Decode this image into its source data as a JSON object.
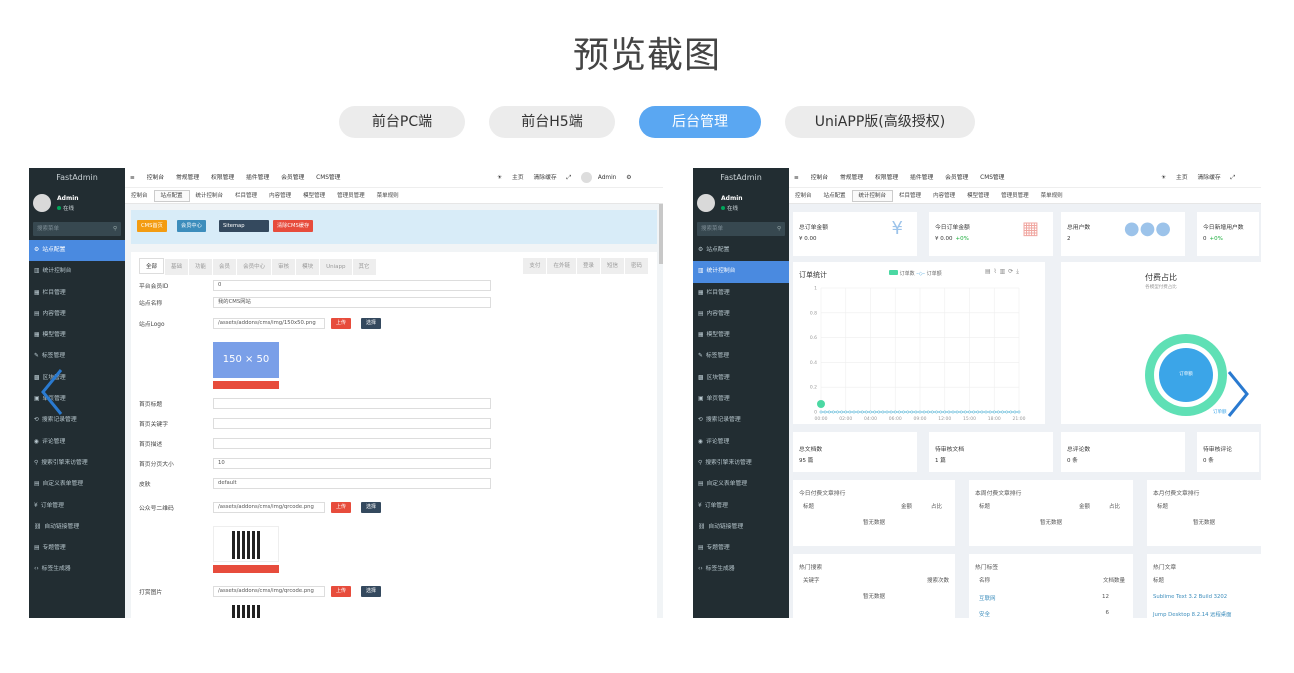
{
  "page_title": "预览截图",
  "tabs": [
    {
      "label": "前台PC端"
    },
    {
      "label": "前台H5端"
    },
    {
      "label": "后台管理"
    },
    {
      "label": "UniAPP版(高级授权)"
    }
  ],
  "colors": {
    "accent": "#5aa7f2",
    "sidebar": "#222d32",
    "active_menu": "#4a8ae0"
  },
  "shot1": {
    "brand": "FastAdmin",
    "user": "Admin",
    "status": "在线",
    "search_placeholder": "搜索菜单",
    "menu": [
      "站点配置",
      "统计控制台",
      "栏目管理",
      "内容管理",
      "模型管理",
      "标签管理",
      "区块管理",
      "单页管理",
      "搜索记录管理",
      "评论管理",
      "搜索引擎来访管理",
      "自定义表单管理",
      "订单管理",
      "自动链接管理",
      "专题管理",
      "标签生成器"
    ],
    "top_nav": [
      "控制台",
      "常规管理",
      "权限管理",
      "插件管理",
      "会员管理",
      "CMS管理"
    ],
    "top_right": [
      "主页",
      "清除缓存",
      "Admin"
    ],
    "sub_tabs": [
      "控制台",
      "站点配置",
      "统计控制台",
      "栏目管理",
      "内容管理",
      "模型管理",
      "管理员管理",
      "菜单规则"
    ],
    "buttons": [
      "CMS首页",
      "会员中心",
      "Sitemap",
      "清除CMS缓存"
    ],
    "form_tabs": [
      "全部",
      "基础",
      "功能",
      "会员",
      "会员中心",
      "审核",
      "模块",
      "Uniapp",
      "其它"
    ],
    "form_tabs_right": [
      "支付",
      "在外链",
      "登录",
      "短信",
      "密码"
    ],
    "fields": [
      {
        "label": "平台会员ID",
        "value": "0"
      },
      {
        "label": "站点名称",
        "value": "我的CMS网站"
      },
      {
        "label": "站点Logo",
        "value": "/assets/addons/cms/img/150x50.png"
      },
      {
        "label": "首页标题",
        "value": ""
      },
      {
        "label": "首页关键字",
        "value": ""
      },
      {
        "label": "首页描述",
        "value": ""
      },
      {
        "label": "首页分页大小",
        "value": "10"
      },
      {
        "label": "皮肤",
        "value": "default"
      },
      {
        "label": "公众号二维码",
        "value": "/assets/addons/cms/img/qrcode.png"
      },
      {
        "label": "打赏图片",
        "value": "/assets/addons/cms/img/qrcode.png"
      }
    ],
    "upload": "上传",
    "choose": "选择",
    "logo_text": "150 × 50"
  },
  "shot2": {
    "brand": "FastAdmin",
    "user": "Admin",
    "status": "在线",
    "search_placeholder": "搜索菜单",
    "menu": [
      "站点配置",
      "统计控制台",
      "栏目管理",
      "内容管理",
      "模型管理",
      "标签管理",
      "区块管理",
      "单页管理",
      "搜索记录管理",
      "评论管理",
      "搜索引擎来访管理",
      "自定义表单管理",
      "订单管理",
      "自动链接管理",
      "专题管理",
      "标签生成器"
    ],
    "top_nav": [
      "控制台",
      "常规管理",
      "权限管理",
      "插件管理",
      "会员管理",
      "CMS管理"
    ],
    "top_right": [
      "主页",
      "清除缓存"
    ],
    "sub_tabs": [
      "控制台",
      "站点配置",
      "统计控制台",
      "栏目管理",
      "内容管理",
      "模型管理",
      "管理员管理",
      "菜单规则"
    ],
    "stats": [
      {
        "title": "总订单金额",
        "value": "¥ 0.00",
        "extra": ""
      },
      {
        "title": "今日订单金额",
        "value": "¥ 0.00",
        "extra": "+0%"
      },
      {
        "title": "总用户数",
        "value": "2",
        "extra": ""
      },
      {
        "title": "今日新增用户数",
        "value": "0",
        "extra": "+0%"
      }
    ],
    "chart_title": "订单统计",
    "chart_legend": [
      "订单数",
      "订单额"
    ],
    "pie_title": "付费占比",
    "pie_subtitle": "各模型付费占比",
    "pie_label": "订单额",
    "pie_outer_label": "订单额",
    "counts": [
      {
        "title": "总文档数",
        "value": "95 篇"
      },
      {
        "title": "待审核文档",
        "value": "1 篇"
      },
      {
        "title": "总评论数",
        "value": "0 条"
      },
      {
        "title": "待审核评论",
        "value": "0 条"
      }
    ],
    "rank_cards": [
      {
        "title": "今日付费文章排行",
        "cols": [
          "标题",
          "金额",
          "占比"
        ],
        "empty": "暂无数据"
      },
      {
        "title": "本周付费文章排行",
        "cols": [
          "标题",
          "金额",
          "占比"
        ],
        "empty": "暂无数据"
      },
      {
        "title": "本月付费文章排行",
        "cols": [
          "标题"
        ],
        "empty": "暂无数据"
      }
    ],
    "hot_search": {
      "title": "热门搜索",
      "cols": [
        "关键字",
        "搜索次数"
      ],
      "empty": "暂无数据"
    },
    "hot_tags": {
      "title": "热门标签",
      "cols": [
        "名称",
        "文档数量"
      ],
      "rows": [
        [
          "互联网",
          "12"
        ],
        [
          "安全",
          "6"
        ]
      ]
    },
    "hot_articles": {
      "title": "热门文章",
      "cols": [
        "标题"
      ],
      "rows": [
        "Sublime Text 3.2 Build 3202",
        "Jump Desktop 8.2.14 远程桌面"
      ]
    }
  },
  "chart_data": {
    "type": "line",
    "title": "订单统计",
    "x": [
      "00:00",
      "02:00",
      "04:00",
      "06:00",
      "09:00",
      "12:00",
      "15:00",
      "18:00",
      "21:00"
    ],
    "ylim": [
      0,
      1
    ],
    "yticks": [
      "0",
      "0.2",
      "0.4",
      "0.6",
      "0.8",
      "1"
    ],
    "series": [
      {
        "name": "订单数",
        "values": [
          0,
          0,
          0,
          0,
          0,
          0,
          0,
          0,
          0
        ]
      },
      {
        "name": "订单额",
        "values": [
          0,
          0,
          0,
          0,
          0,
          0,
          0,
          0,
          0
        ]
      }
    ]
  }
}
